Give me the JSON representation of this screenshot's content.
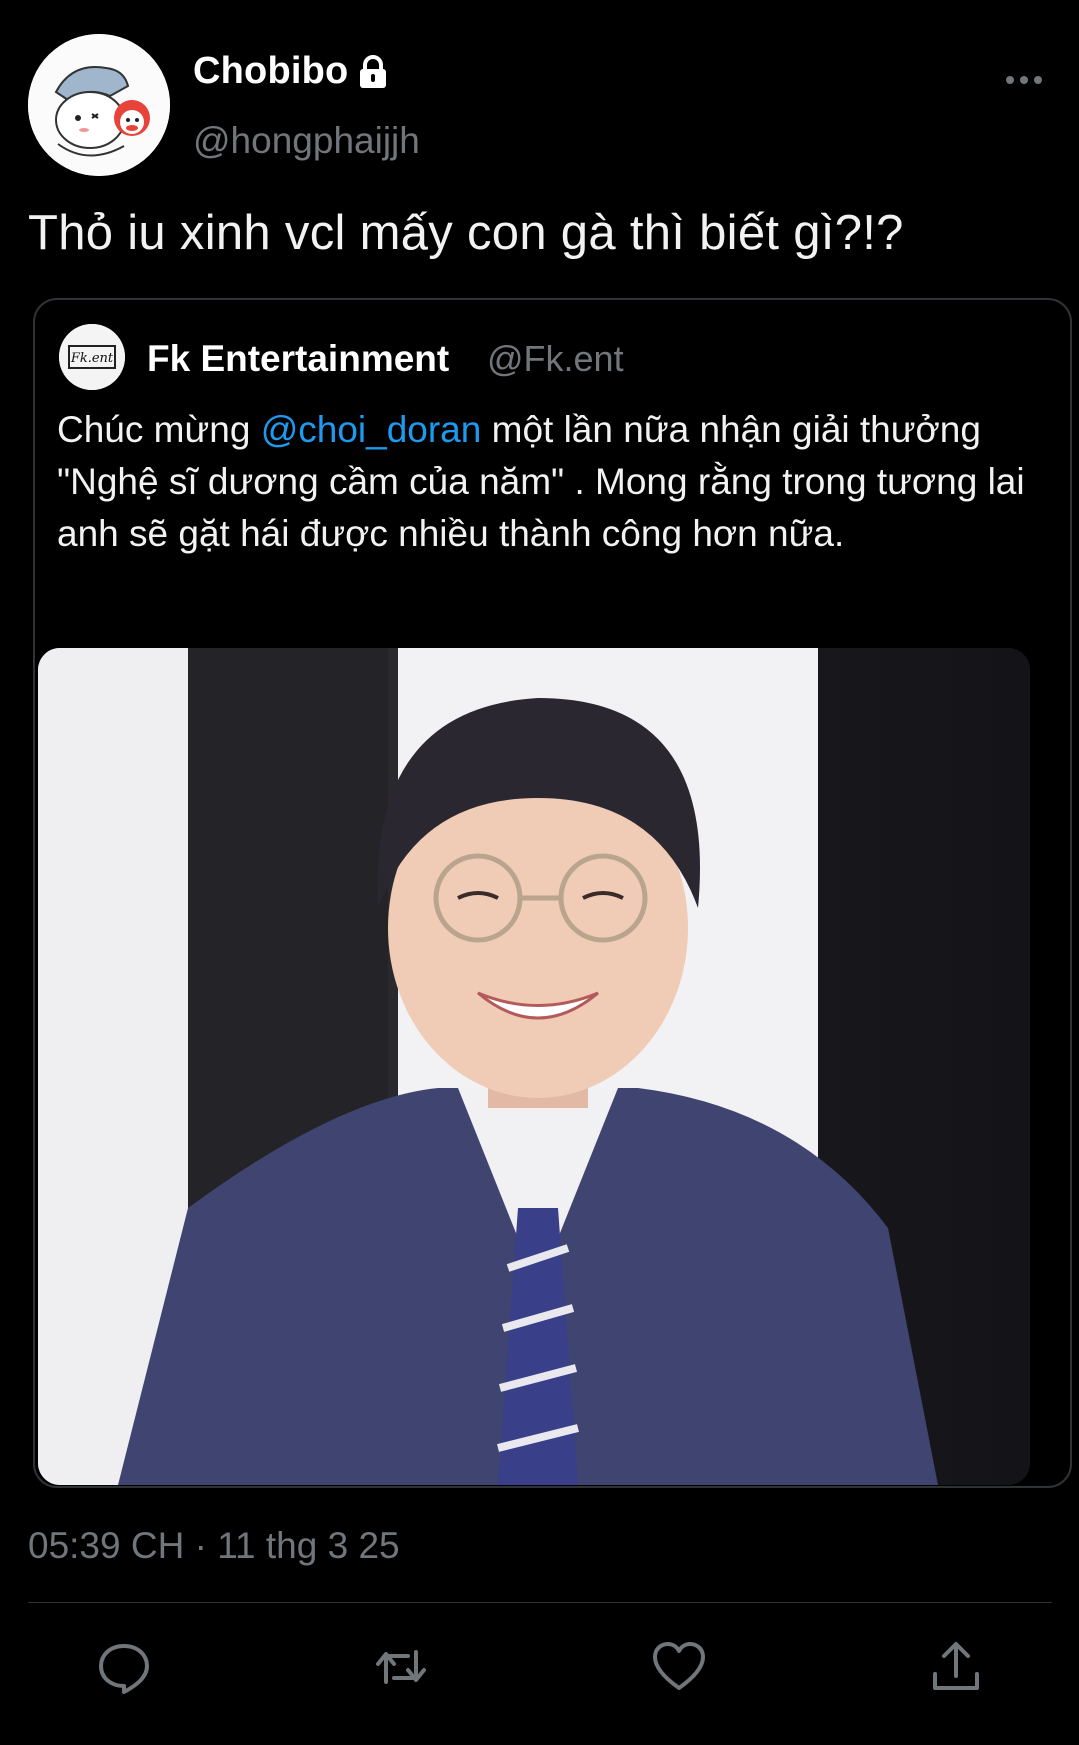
{
  "author": {
    "display_name": "Chobibo",
    "handle": "@hongphaijjh",
    "avatar_icon": "cartoon-avatar-icon",
    "locked_icon": "lock-icon"
  },
  "tweet": {
    "text": "Thỏ iu xinh vcl mấy con gà thì biết gì?!?"
  },
  "quoted": {
    "display_name": "Fk Entertainment",
    "handle": "@Fk.ent",
    "avatar_text": "Fk.ent",
    "text_before": " Chúc mừng ",
    "mention": "@choi_doran",
    "text_after": " một lần nữa nhận giải thưởng \"Nghệ sĩ dương cầm của năm\" . Mong rằng trong tương lai anh sẽ gặt hái được nhiều thành công hơn nữa."
  },
  "meta": {
    "time": "05:39 CH",
    "separator": "·",
    "date": "11 thg 3 25"
  },
  "actions": [
    "reply-icon",
    "retweet-icon",
    "like-icon",
    "share-icon"
  ],
  "colors": {
    "background": "#000000",
    "text": "#e7e9ea",
    "secondary": "#71767b",
    "accent": "#1d9bf0",
    "border": "#2f3336"
  }
}
